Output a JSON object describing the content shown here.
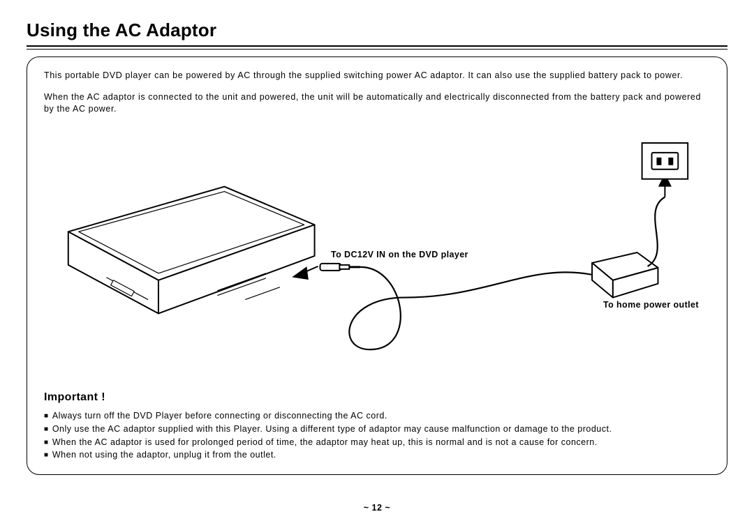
{
  "title": "Using the AC Adaptor",
  "paragraphs": {
    "p1": "This portable DVD player can be powered by AC through the supplied switching power AC adaptor. It can also use the supplied battery pack to power.",
    "p2": "When the AC adaptor is connected to the unit and powered, the unit will be automatically and electrically disconnected from the battery pack and powered by the AC power."
  },
  "labels": {
    "dc_in": "To DC12V IN on the DVD player",
    "outlet": "To home power outlet"
  },
  "important": {
    "heading": "Important !",
    "b1": "Always turn off the DVD Player before connecting or disconnecting the AC cord.",
    "b2": "Only use the AC adaptor supplied with this Player. Using a different type of adaptor may cause malfunction or damage to the product.",
    "b3": "When the AC adaptor is used for prolonged period of time, the adaptor may heat up, this is normal and is not a cause for concern.",
    "b4": "When not using the adaptor, unplug it from the outlet."
  },
  "page_number": "~ 12 ~"
}
